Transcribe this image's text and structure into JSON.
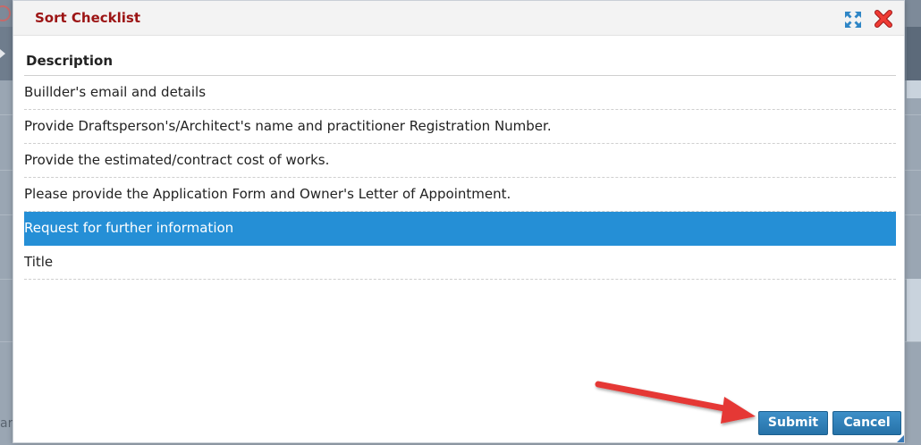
{
  "background": {
    "left_fragment": "ar"
  },
  "dialog": {
    "title": "Sort Checklist",
    "expand_icon": "expand-icon",
    "close_icon": "close-icon",
    "list": {
      "header": "Description",
      "items": [
        {
          "label": "Buillder's email and details",
          "selected": false
        },
        {
          "label": "Provide Draftsperson's/Architect's name and practitioner Registration Number.",
          "selected": false
        },
        {
          "label": "Provide the estimated/contract cost of works.",
          "selected": false
        },
        {
          "label": "Please provide the Application Form and Owner's Letter of Appointment.",
          "selected": false
        },
        {
          "label": "Request for further information",
          "selected": true
        },
        {
          "label": "Title",
          "selected": false
        }
      ]
    },
    "buttons": {
      "submit": "Submit",
      "cancel": "Cancel"
    }
  },
  "colors": {
    "title": "#9c1414",
    "selection": "#258fd6",
    "button": "#2672a8",
    "annotation_arrow": "#e53935",
    "close_icon": "#e53935",
    "expand_icon": "#2f86c6"
  }
}
